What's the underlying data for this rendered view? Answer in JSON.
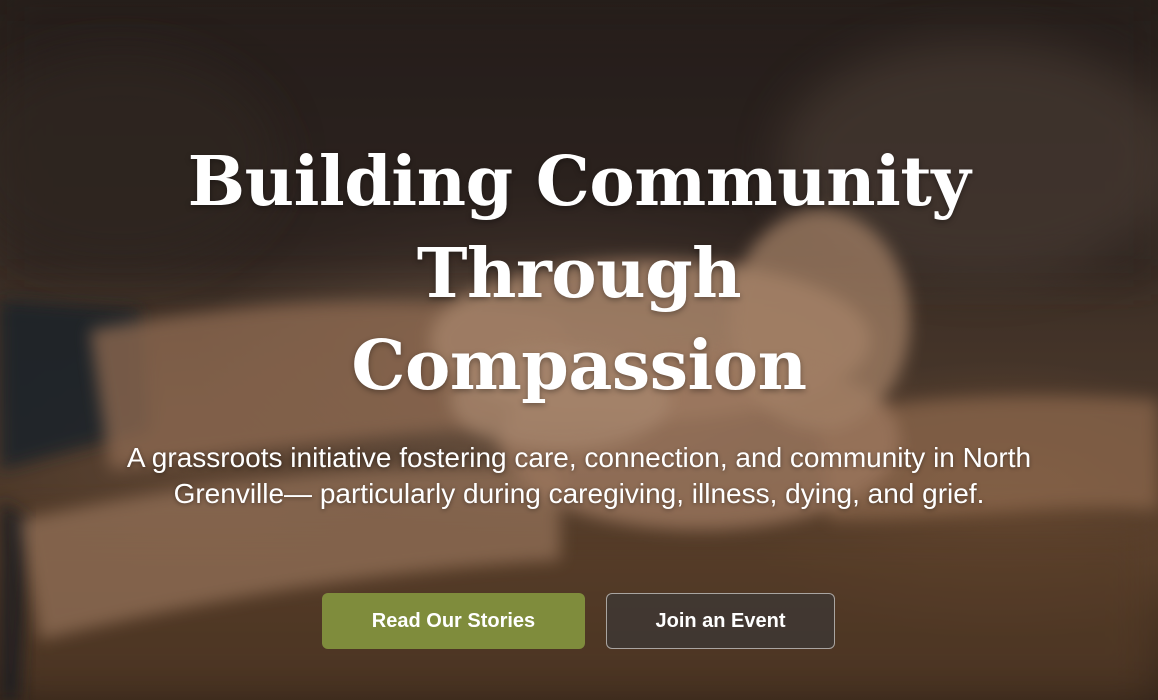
{
  "hero": {
    "headline_lines": [
      "Building Community",
      "Through",
      "Compassion"
    ],
    "subtitle": "A grassroots initiative fostering care, connection, and community in North Grenville— particularly during caregiving, illness, dying, and grief.",
    "primary_button": "Read Our Stories",
    "secondary_button": "Join an Event",
    "image_description": "",
    "colors": {
      "primary_button_bg": "#7f8c3c",
      "secondary_button_bg": "#3c3836",
      "text": "#ffffff"
    }
  }
}
